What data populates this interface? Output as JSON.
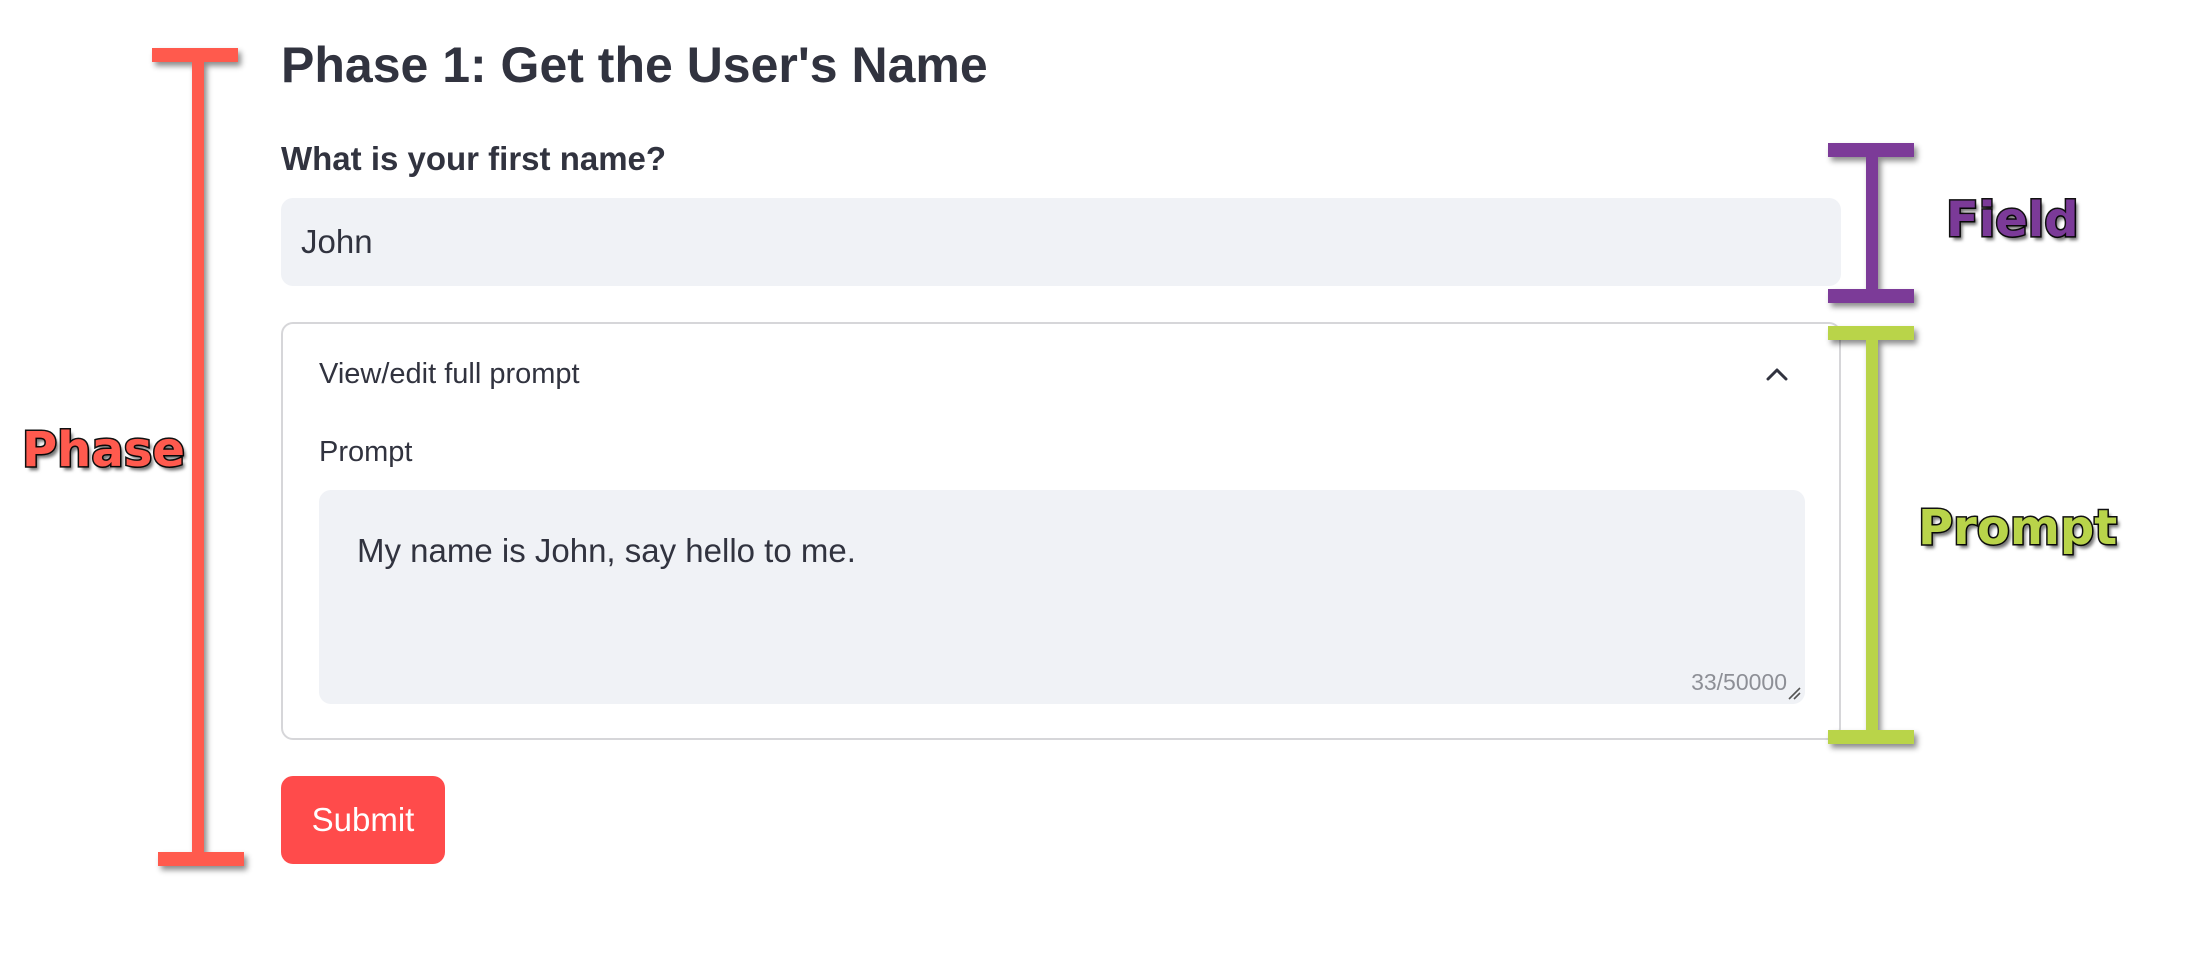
{
  "form": {
    "title": "Phase 1: Get the User's Name",
    "name_field": {
      "label": "What is your first name?",
      "value": "John"
    },
    "expander": {
      "title": "View/edit full prompt",
      "state": "expanded",
      "chevron_icon": "chevron-up-icon",
      "prompt_label": "Prompt",
      "prompt_value": "My name is John, say hello to me.",
      "char_count": "33/50000"
    },
    "submit_label": "Submit"
  },
  "annotations": {
    "phase": {
      "label": "Phase",
      "color": "#ff5a4e"
    },
    "field": {
      "label": "Field",
      "color": "#7b3a98"
    },
    "prompt": {
      "label": "Prompt",
      "color": "#b9d44a"
    }
  },
  "colors": {
    "text": "#31333f",
    "input_bg": "#f0f2f6",
    "border": "#d6d6d9",
    "accent": "#ff4b4b",
    "muted": "#8d8f96"
  }
}
